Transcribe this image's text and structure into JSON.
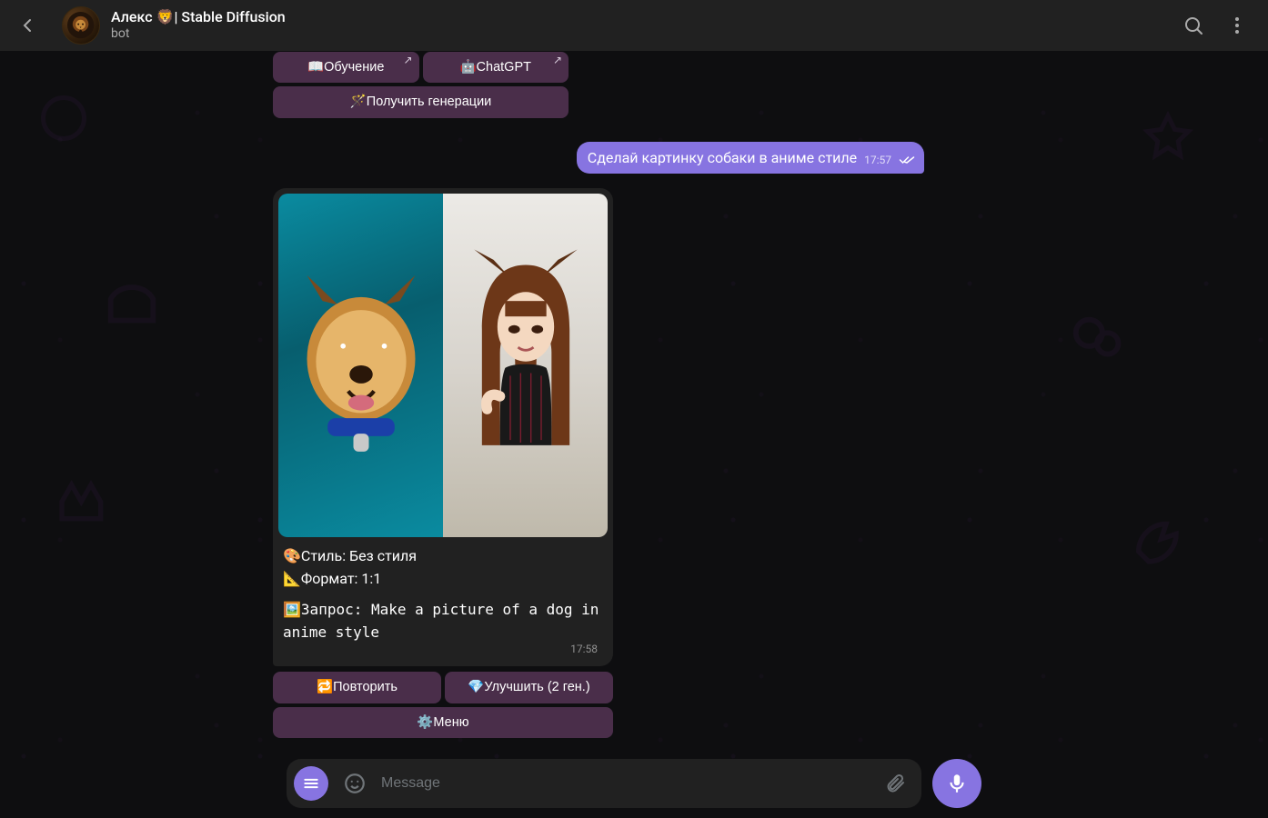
{
  "header": {
    "title": "Алекс 🦁| Stable Diffusion",
    "subtitle": "bot"
  },
  "composer": {
    "placeholder": "Message"
  },
  "top_keyboard": {
    "training": "📖Обучение",
    "chatgpt": "🤖ChatGPT",
    "get_gen": "🪄Получить генерации"
  },
  "user_message": {
    "text": "Сделай картинку собаки в аниме стиле",
    "time": "17:57"
  },
  "bot_message": {
    "style_line": "🎨Стиль: Без стиля",
    "format_line": "📐Формат: 1:1",
    "query_line": "🖼️Запрос: Make a picture of a dog in anime style",
    "time": "17:58"
  },
  "bottom_keyboard": {
    "repeat": "🔁Повторить",
    "improve": "💎Улучшить (2 ген.)",
    "menu": "⚙️Меню"
  }
}
